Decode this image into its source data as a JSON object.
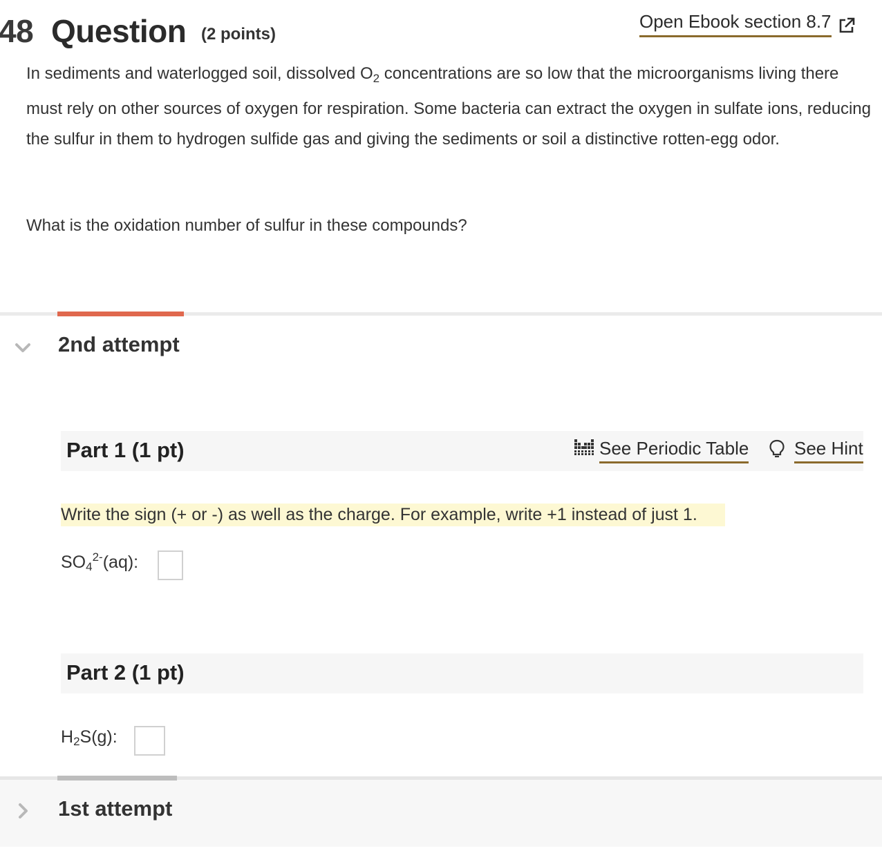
{
  "question": {
    "number": "48",
    "label": "Question",
    "points": "(2 points)",
    "ebook_link": "Open Ebook section 8.7",
    "paragraph_1_a": "In sediments and waterlogged soil, dissolved O",
    "paragraph_1_sub": "2",
    "paragraph_1_b": " concentrations are so low that the microorganisms living there must rely on other sources of oxygen for respiration. Some bacteria can extract the oxygen in sulfate ions, reducing the sulfur in them to hydrogen sulfide gas and giving the sediments or soil a distinctive rotten-egg odor.",
    "paragraph_2": "What is the oxidation number of sulfur in these compounds?"
  },
  "attempt_current": {
    "title": "2nd attempt",
    "part1": {
      "title": "Part 1 (1 pt)",
      "periodic_table_link": "See Periodic Table",
      "hint_link": "See Hint",
      "instruction": "Write the sign (+ or -) as well as the charge.  For example, write +1 instead of just 1.",
      "formula_a": "SO",
      "formula_sub": "4",
      "formula_sup": "2-",
      "formula_b": "(aq):",
      "answer": ""
    },
    "part2": {
      "title": "Part 2 (1 pt)",
      "formula_a": "H",
      "formula_sub": "2",
      "formula_b": "S(g):",
      "answer": ""
    }
  },
  "attempt_previous": {
    "title": "1st attempt"
  },
  "colors": {
    "accent": "#e0684e",
    "link_underline": "#8a6a2c",
    "hint_highlight": "#fdf8d3",
    "collapsed_bar": "#bdbdbd"
  }
}
